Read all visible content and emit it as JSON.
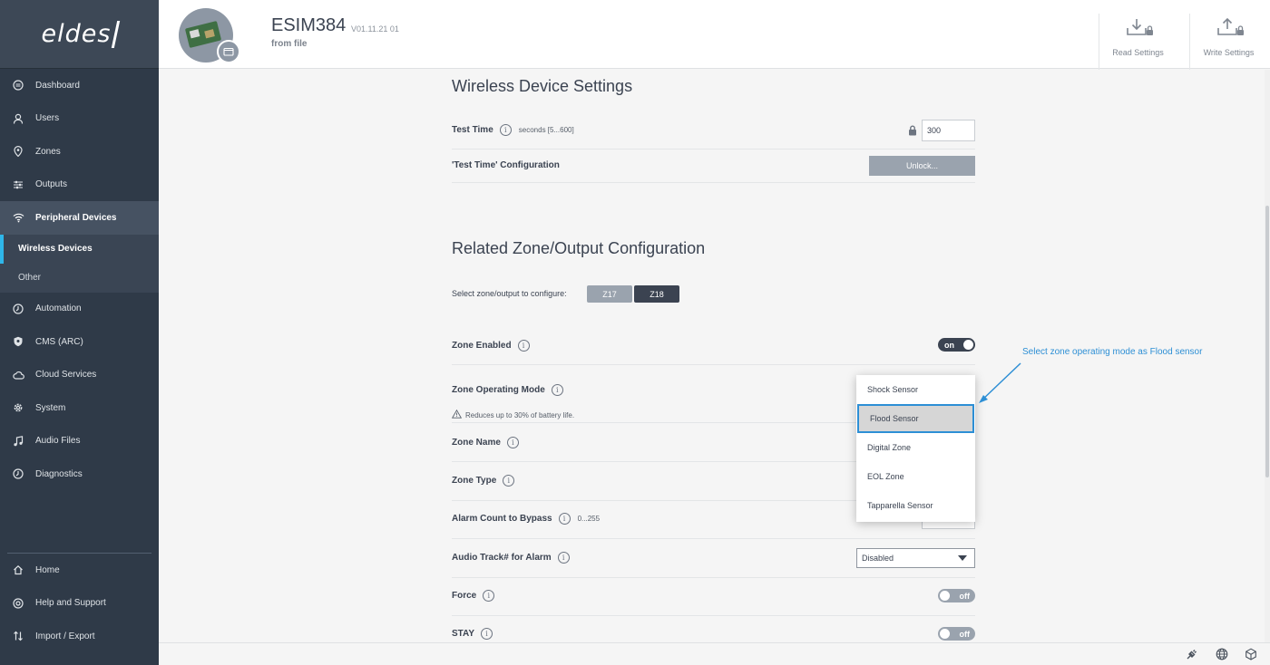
{
  "brand": {
    "logo": "eldes"
  },
  "sidebar": {
    "items": [
      {
        "label": "Dashboard",
        "icon": "dashboard-icon"
      },
      {
        "label": "Users",
        "icon": "user-icon"
      },
      {
        "label": "Zones",
        "icon": "location-pin-icon"
      },
      {
        "label": "Outputs",
        "icon": "sliders-icon"
      },
      {
        "label": "Peripheral Devices",
        "icon": "wifi-icon"
      }
    ],
    "sub_items": [
      {
        "label": "Wireless Devices"
      },
      {
        "label": "Other"
      }
    ],
    "items2": [
      {
        "label": "Automation",
        "icon": "automation-icon"
      },
      {
        "label": "CMS (ARC)",
        "icon": "shield-icon"
      },
      {
        "label": "Cloud Services",
        "icon": "cloud-icon"
      },
      {
        "label": "System",
        "icon": "gear-icon"
      },
      {
        "label": "Audio Files",
        "icon": "music-icon"
      },
      {
        "label": "Diagnostics",
        "icon": "diagnostics-icon"
      }
    ],
    "bottom": [
      {
        "label": "Home",
        "icon": "home-icon"
      },
      {
        "label": "Help and Support",
        "icon": "help-icon"
      },
      {
        "label": "Import / Export",
        "icon": "import-export-icon"
      }
    ]
  },
  "header": {
    "device_name": "ESIM384",
    "version": "V01.11.21 01",
    "source": "from file",
    "read_label": "Read Settings",
    "write_label": "Write Settings"
  },
  "wireless": {
    "title": "Wireless Device Settings",
    "test_time_label": "Test Time",
    "test_time_hint": "seconds [5...600]",
    "test_time_value": "300",
    "test_config_label": "'Test Time' Configuration",
    "unlock_label": "Unlock..."
  },
  "related": {
    "title": "Related Zone/Output Configuration",
    "select_label": "Select zone/output to configure:",
    "zones": [
      "Z17",
      "Z18"
    ],
    "zone_enabled_label": "Zone Enabled",
    "zone_enabled_state": "on",
    "operating_mode_label": "Zone Operating Mode",
    "warning": "Reduces up to 30% of battery life.",
    "zone_name_label": "Zone Name",
    "zone_type_label": "Zone Type",
    "alarm_count_label": "Alarm Count to Bypass",
    "alarm_count_hint": "0...255",
    "audio_track_label": "Audio Track# for Alarm",
    "audio_track_value": "Disabled",
    "force_label": "Force",
    "force_state": "off",
    "stay_label": "STAY",
    "stay_state": "off"
  },
  "dropdown": {
    "options": [
      "Shock Sensor",
      "Flood Sensor",
      "Digital Zone",
      "EOL Zone",
      "Tapparella Sensor"
    ],
    "selected": "Flood Sensor"
  },
  "annotation": "Select zone operating mode as Flood sensor",
  "colors": {
    "sidebar": "#2f3a48",
    "accent": "#2fb6e9",
    "annotation": "#2d8fd5"
  }
}
